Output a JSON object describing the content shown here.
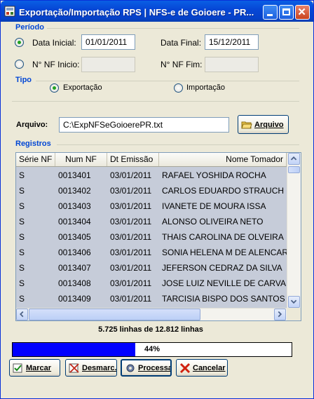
{
  "window": {
    "title": "Exportação/Importação RPS | NFS-e de Goioere - PR..."
  },
  "periodo": {
    "section_label": "Período",
    "data_inicial_label": "Data Inicial:",
    "data_inicial_value": "01/01/2011",
    "data_final_label": "Data Final:",
    "data_final_value": "15/12/2011",
    "nf_inicio_label": "N° NF Inicio:",
    "nf_inicio_value": "",
    "nf_fim_label": "N° NF Fim:",
    "nf_fim_value": "",
    "selected": "data"
  },
  "tipo": {
    "section_label": "Tipo",
    "exportacao_label": "Exportação",
    "importacao_label": "Importação",
    "selected": "exportacao"
  },
  "arquivo": {
    "label": "Arquivo:",
    "value": "C:\\ExpNFSeGoioerePR.txt",
    "button_label": "Arquivo"
  },
  "registros": {
    "section_label": "Registros",
    "columns": [
      "Série NF",
      "Num NF",
      "Dt Emissão",
      "Nome Tomador"
    ],
    "rows": [
      [
        "S",
        "0013401",
        "03/01/2011",
        "RAFAEL YOSHIDA ROCHA"
      ],
      [
        "S",
        "0013402",
        "03/01/2011",
        "CARLOS EDUARDO STRAUCH"
      ],
      [
        "S",
        "0013403",
        "03/01/2011",
        "IVANETE DE MOURA ISSA"
      ],
      [
        "S",
        "0013404",
        "03/01/2011",
        "ALONSO OLIVEIRA NETO"
      ],
      [
        "S",
        "0013405",
        "03/01/2011",
        "THAIS CAROLINA DE OLVEIRA"
      ],
      [
        "S",
        "0013406",
        "03/01/2011",
        "SONIA HELENA M DE ALENCAR"
      ],
      [
        "S",
        "0013407",
        "03/01/2011",
        "JEFERSON CEDRAZ DA SILVA"
      ],
      [
        "S",
        "0013408",
        "03/01/2011",
        "JOSE LUIZ NEVILLE DE CARVALHO"
      ],
      [
        "S",
        "0013409",
        "03/01/2011",
        "TARCISIA BISPO DOS SANTOS"
      ]
    ]
  },
  "status": {
    "summary": "5.725 linhas de 12.812 linhas",
    "progress_fraction": 0.44,
    "progress_label": "44%"
  },
  "buttons": {
    "marcar": "Marcar",
    "desmarcar": "Desmarc.",
    "processar": "Processar",
    "cancelar": "Cancelar"
  },
  "icons": {
    "app": "app-icon",
    "folder": "folder-icon",
    "processar": "gear-icon",
    "cancelar": "cancel-x-icon"
  }
}
